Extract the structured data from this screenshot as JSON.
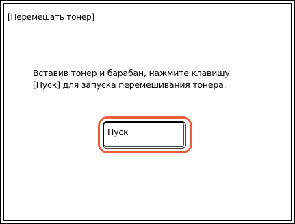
{
  "dialog": {
    "title": "[Перемешать тонер]",
    "message_line1": "Вставив тонер и барабан, нажмите клавишу",
    "message_line2": "[Пуск] для запуска перемешивания тонера.",
    "start_button_label": "Пуск"
  },
  "colors": {
    "highlight": "#e8603c",
    "background": "#ffffff",
    "foreground": "#000000"
  }
}
